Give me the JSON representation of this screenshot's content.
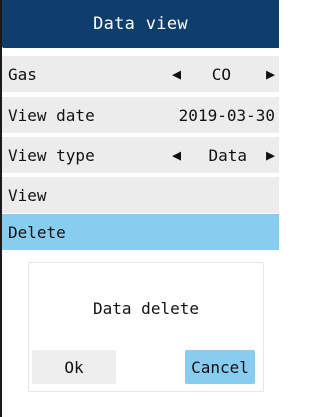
{
  "title": "Data view",
  "rows": {
    "gas": {
      "label": "Gas",
      "value": "CO",
      "prev_arrow": "◀",
      "next_arrow": "▶"
    },
    "view_date": {
      "label": "View date",
      "value": "2019-03-30"
    },
    "view_type": {
      "label": "View type",
      "value": "Data",
      "prev_arrow": "◀",
      "next_arrow": "▶"
    },
    "view": {
      "label": "View"
    },
    "delete": {
      "label": "Delete"
    }
  },
  "dialog": {
    "message": "Data delete",
    "ok_label": "Ok",
    "cancel_label": "Cancel"
  },
  "colors": {
    "title_bg": "#0f3e6d",
    "row_bg": "#ececec",
    "selected_bg": "#87cdef",
    "button_bg": "#eeeeee"
  },
  "icons": {
    "prev": "left-triangle-icon",
    "next": "right-triangle-icon"
  }
}
